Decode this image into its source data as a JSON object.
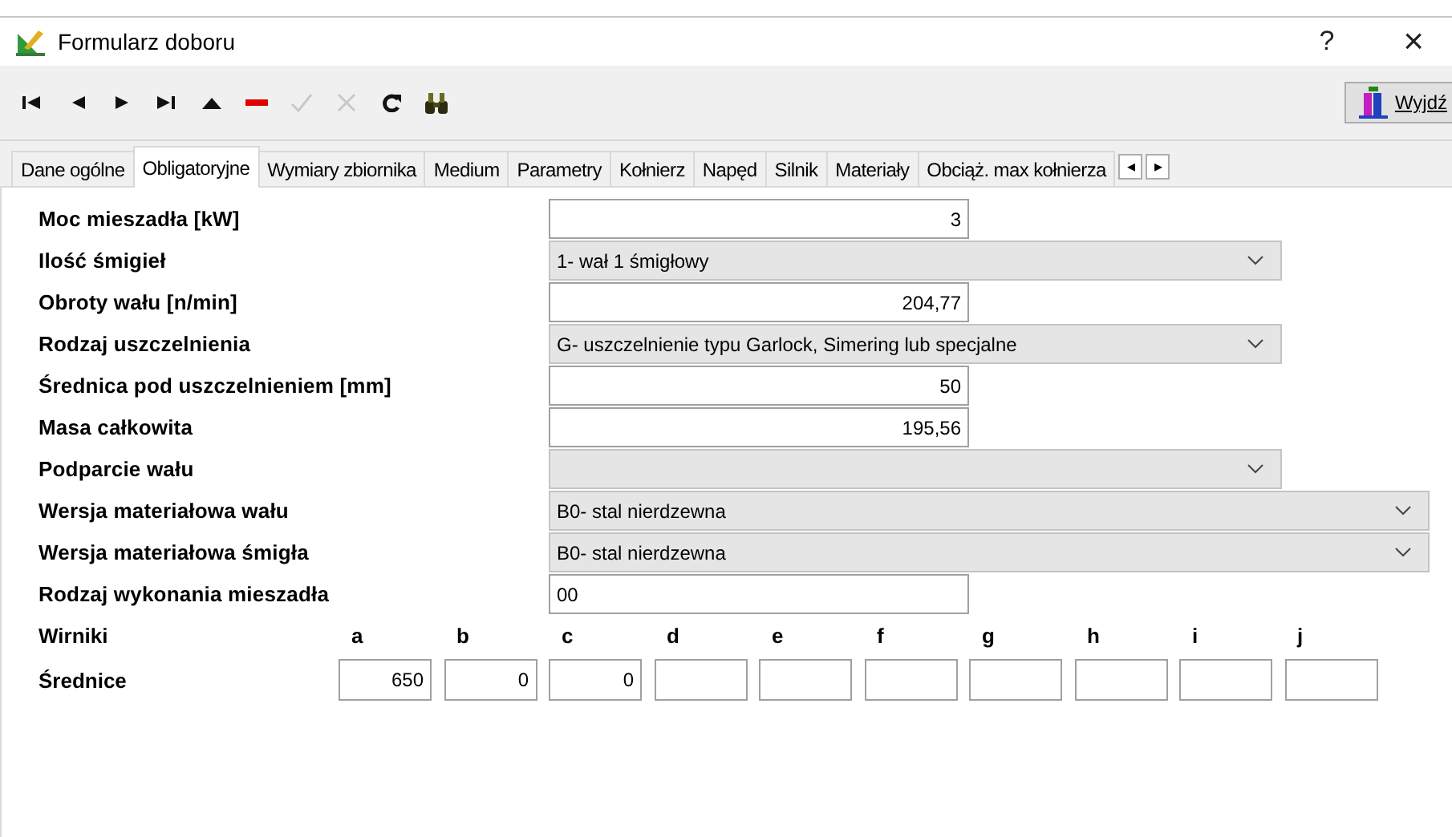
{
  "window": {
    "title": "Formularz doboru",
    "help": "?",
    "close": "×"
  },
  "toolbar": [
    {
      "kind": "first",
      "disabled": false
    },
    {
      "kind": "prev",
      "disabled": false
    },
    {
      "kind": "next",
      "disabled": false
    },
    {
      "kind": "last",
      "disabled": false
    },
    {
      "kind": "up",
      "disabled": false
    },
    {
      "kind": "delete",
      "disabled": false
    },
    {
      "kind": "confirm",
      "disabled": true
    },
    {
      "kind": "cancel",
      "disabled": true
    },
    {
      "kind": "refresh",
      "disabled": false
    },
    {
      "kind": "find",
      "disabled": false
    }
  ],
  "exit_button": {
    "label": "Wyjdź"
  },
  "tabs": [
    {
      "label": "Dane ogólne",
      "selected": false
    },
    {
      "label": "Obligatoryjne",
      "selected": true
    },
    {
      "label": "Wymiary zbiornika",
      "selected": false
    },
    {
      "label": "Medium",
      "selected": false
    },
    {
      "label": "Parametry",
      "selected": false
    },
    {
      "label": "Kołnierz",
      "selected": false
    },
    {
      "label": "Napęd",
      "selected": false
    },
    {
      "label": "Silnik",
      "selected": false
    },
    {
      "label": "Materiały",
      "selected": false
    },
    {
      "label": "Obciąż. max kołnierza",
      "selected": false
    }
  ],
  "tab_scroll": {
    "left": "◂",
    "right": "▸"
  },
  "fields": [
    {
      "label": "Moc mieszadła [kW]",
      "kind": "number",
      "value": "3"
    },
    {
      "label": "Ilość śmigieł",
      "kind": "select",
      "value": "1- wał 1 śmigłowy"
    },
    {
      "label": "Obroty wału  [n/min]",
      "kind": "number",
      "value": "204,77"
    },
    {
      "label": "Rodzaj uszczelnienia",
      "kind": "select",
      "value": "G- uszczelnienie typu Garlock, Simering lub specjalne"
    },
    {
      "label": "Średnica pod uszczelnieniem [mm]",
      "kind": "number",
      "value": "50"
    },
    {
      "label": "Masa całkowita",
      "kind": "number",
      "value": "195,56"
    },
    {
      "label": "Podparcie wału",
      "kind": "select"
    },
    {
      "label": "Wersja materiałowa wału",
      "kind": "long-select",
      "value": "B0- stal nierdzewna"
    },
    {
      "label": "Wersja materiałowa śmigła",
      "kind": "long-select",
      "value": "B0- stal nierdzewna"
    },
    {
      "label": "Rodzaj wykonania mieszadła",
      "kind": "text",
      "value": "00"
    }
  ],
  "impellers": {
    "label": "Wirniki",
    "diameters_label": "Średnice",
    "columns": [
      {
        "letter": "a",
        "value": "650"
      },
      {
        "letter": "b",
        "value": "0"
      },
      {
        "letter": "c",
        "value": "0"
      },
      {
        "letter": "d"
      },
      {
        "letter": "e"
      },
      {
        "letter": "f"
      },
      {
        "letter": "g"
      },
      {
        "letter": "h"
      },
      {
        "letter": "i"
      },
      {
        "letter": "j"
      }
    ]
  }
}
